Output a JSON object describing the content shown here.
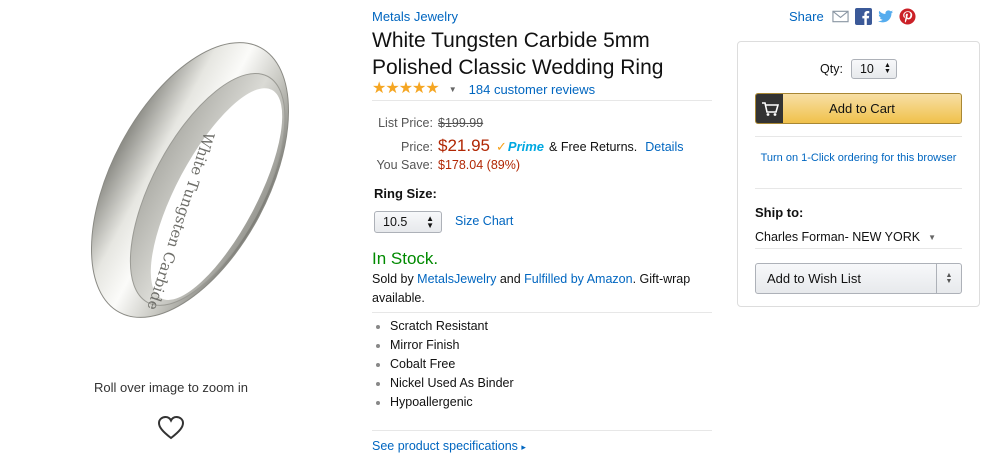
{
  "image": {
    "zoom_hint": "Roll over image to zoom in",
    "engraving_text": "White Tungsten Carbide"
  },
  "product": {
    "brand": "Metals Jewelry",
    "title": "White Tungsten Carbide 5mm Polished Classic Wedding Ring",
    "rating_stars": 5,
    "review_count": "184 customer reviews"
  },
  "pricing": {
    "list_price_label": "List Price:",
    "list_price": "$199.99",
    "price_label": "Price:",
    "price": "$21.95",
    "prime": "Prime",
    "free_returns": "& Free Returns.",
    "details_link": "Details",
    "you_save_label": "You Save:",
    "you_save": "$178.04 (89%)"
  },
  "ring_size": {
    "label": "Ring Size:",
    "selected": "10.5",
    "size_chart_link": "Size Chart"
  },
  "availability": {
    "stock": "In Stock.",
    "sold_by_prefix": "Sold by ",
    "seller": "MetalsJewelry",
    "and": " and ",
    "fulfilled": "Fulfilled by Amazon",
    "suffix": ". Gift-wrap available."
  },
  "features": [
    "Scratch Resistant",
    "Mirror Finish",
    "Cobalt Free",
    "Nickel Used As Binder",
    "Hypoallergenic"
  ],
  "see_specs": "See product specifications",
  "share": {
    "label": "Share",
    "icons": [
      "email-icon",
      "facebook-icon",
      "twitter-icon",
      "pinterest-icon"
    ]
  },
  "buybox": {
    "qty_label": "Qty:",
    "qty_value": "10",
    "add_to_cart": "Add to Cart",
    "one_click": "Turn on 1-Click ordering for this browser",
    "ship_to_label": "Ship to:",
    "ship_address": "Charles Forman- NEW YORK",
    "wishlist": "Add to Wish List"
  },
  "colors": {
    "link": "#0066c0",
    "price": "#b12704",
    "in_stock": "#008a00",
    "cart_button": "#f0c14b",
    "prime": "#00a8e1"
  }
}
